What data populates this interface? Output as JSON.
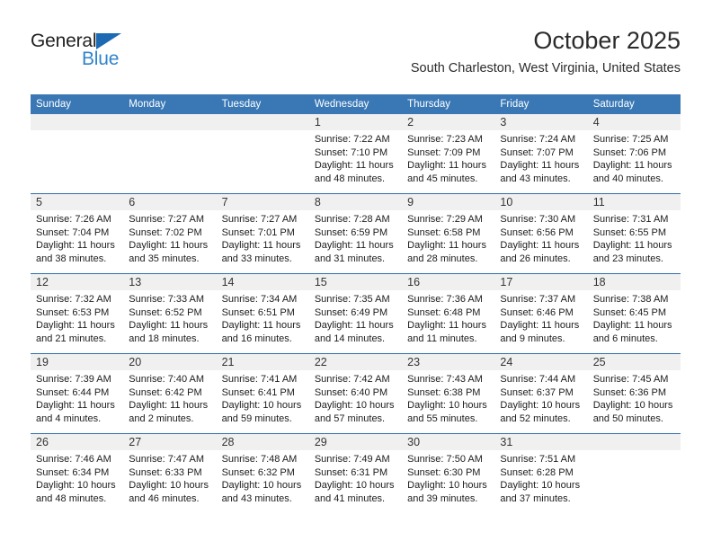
{
  "brand": {
    "name_part1": "General",
    "name_part2": "Blue",
    "triangle_color": "#1b6ab3",
    "blue_text_color": "#2f84cc"
  },
  "header": {
    "title": "October 2025",
    "subtitle": "South Charleston, West Virginia, United States"
  },
  "theme": {
    "header_blue": "#3a78b5",
    "row_divider_blue": "#2f6fad",
    "daynum_band": "#f0f0f0"
  },
  "weekdays": [
    "Sunday",
    "Monday",
    "Tuesday",
    "Wednesday",
    "Thursday",
    "Friday",
    "Saturday"
  ],
  "weeks": [
    [
      {
        "day": "",
        "sunrise": "",
        "sunset": "",
        "daylight1": "",
        "daylight2": ""
      },
      {
        "day": "",
        "sunrise": "",
        "sunset": "",
        "daylight1": "",
        "daylight2": ""
      },
      {
        "day": "",
        "sunrise": "",
        "sunset": "",
        "daylight1": "",
        "daylight2": ""
      },
      {
        "day": "1",
        "sunrise": "Sunrise: 7:22 AM",
        "sunset": "Sunset: 7:10 PM",
        "daylight1": "Daylight: 11 hours",
        "daylight2": "and 48 minutes."
      },
      {
        "day": "2",
        "sunrise": "Sunrise: 7:23 AM",
        "sunset": "Sunset: 7:09 PM",
        "daylight1": "Daylight: 11 hours",
        "daylight2": "and 45 minutes."
      },
      {
        "day": "3",
        "sunrise": "Sunrise: 7:24 AM",
        "sunset": "Sunset: 7:07 PM",
        "daylight1": "Daylight: 11 hours",
        "daylight2": "and 43 minutes."
      },
      {
        "day": "4",
        "sunrise": "Sunrise: 7:25 AM",
        "sunset": "Sunset: 7:06 PM",
        "daylight1": "Daylight: 11 hours",
        "daylight2": "and 40 minutes."
      }
    ],
    [
      {
        "day": "5",
        "sunrise": "Sunrise: 7:26 AM",
        "sunset": "Sunset: 7:04 PM",
        "daylight1": "Daylight: 11 hours",
        "daylight2": "and 38 minutes."
      },
      {
        "day": "6",
        "sunrise": "Sunrise: 7:27 AM",
        "sunset": "Sunset: 7:02 PM",
        "daylight1": "Daylight: 11 hours",
        "daylight2": "and 35 minutes."
      },
      {
        "day": "7",
        "sunrise": "Sunrise: 7:27 AM",
        "sunset": "Sunset: 7:01 PM",
        "daylight1": "Daylight: 11 hours",
        "daylight2": "and 33 minutes."
      },
      {
        "day": "8",
        "sunrise": "Sunrise: 7:28 AM",
        "sunset": "Sunset: 6:59 PM",
        "daylight1": "Daylight: 11 hours",
        "daylight2": "and 31 minutes."
      },
      {
        "day": "9",
        "sunrise": "Sunrise: 7:29 AM",
        "sunset": "Sunset: 6:58 PM",
        "daylight1": "Daylight: 11 hours",
        "daylight2": "and 28 minutes."
      },
      {
        "day": "10",
        "sunrise": "Sunrise: 7:30 AM",
        "sunset": "Sunset: 6:56 PM",
        "daylight1": "Daylight: 11 hours",
        "daylight2": "and 26 minutes."
      },
      {
        "day": "11",
        "sunrise": "Sunrise: 7:31 AM",
        "sunset": "Sunset: 6:55 PM",
        "daylight1": "Daylight: 11 hours",
        "daylight2": "and 23 minutes."
      }
    ],
    [
      {
        "day": "12",
        "sunrise": "Sunrise: 7:32 AM",
        "sunset": "Sunset: 6:53 PM",
        "daylight1": "Daylight: 11 hours",
        "daylight2": "and 21 minutes."
      },
      {
        "day": "13",
        "sunrise": "Sunrise: 7:33 AM",
        "sunset": "Sunset: 6:52 PM",
        "daylight1": "Daylight: 11 hours",
        "daylight2": "and 18 minutes."
      },
      {
        "day": "14",
        "sunrise": "Sunrise: 7:34 AM",
        "sunset": "Sunset: 6:51 PM",
        "daylight1": "Daylight: 11 hours",
        "daylight2": "and 16 minutes."
      },
      {
        "day": "15",
        "sunrise": "Sunrise: 7:35 AM",
        "sunset": "Sunset: 6:49 PM",
        "daylight1": "Daylight: 11 hours",
        "daylight2": "and 14 minutes."
      },
      {
        "day": "16",
        "sunrise": "Sunrise: 7:36 AM",
        "sunset": "Sunset: 6:48 PM",
        "daylight1": "Daylight: 11 hours",
        "daylight2": "and 11 minutes."
      },
      {
        "day": "17",
        "sunrise": "Sunrise: 7:37 AM",
        "sunset": "Sunset: 6:46 PM",
        "daylight1": "Daylight: 11 hours",
        "daylight2": "and 9 minutes."
      },
      {
        "day": "18",
        "sunrise": "Sunrise: 7:38 AM",
        "sunset": "Sunset: 6:45 PM",
        "daylight1": "Daylight: 11 hours",
        "daylight2": "and 6 minutes."
      }
    ],
    [
      {
        "day": "19",
        "sunrise": "Sunrise: 7:39 AM",
        "sunset": "Sunset: 6:44 PM",
        "daylight1": "Daylight: 11 hours",
        "daylight2": "and 4 minutes."
      },
      {
        "day": "20",
        "sunrise": "Sunrise: 7:40 AM",
        "sunset": "Sunset: 6:42 PM",
        "daylight1": "Daylight: 11 hours",
        "daylight2": "and 2 minutes."
      },
      {
        "day": "21",
        "sunrise": "Sunrise: 7:41 AM",
        "sunset": "Sunset: 6:41 PM",
        "daylight1": "Daylight: 10 hours",
        "daylight2": "and 59 minutes."
      },
      {
        "day": "22",
        "sunrise": "Sunrise: 7:42 AM",
        "sunset": "Sunset: 6:40 PM",
        "daylight1": "Daylight: 10 hours",
        "daylight2": "and 57 minutes."
      },
      {
        "day": "23",
        "sunrise": "Sunrise: 7:43 AM",
        "sunset": "Sunset: 6:38 PM",
        "daylight1": "Daylight: 10 hours",
        "daylight2": "and 55 minutes."
      },
      {
        "day": "24",
        "sunrise": "Sunrise: 7:44 AM",
        "sunset": "Sunset: 6:37 PM",
        "daylight1": "Daylight: 10 hours",
        "daylight2": "and 52 minutes."
      },
      {
        "day": "25",
        "sunrise": "Sunrise: 7:45 AM",
        "sunset": "Sunset: 6:36 PM",
        "daylight1": "Daylight: 10 hours",
        "daylight2": "and 50 minutes."
      }
    ],
    [
      {
        "day": "26",
        "sunrise": "Sunrise: 7:46 AM",
        "sunset": "Sunset: 6:34 PM",
        "daylight1": "Daylight: 10 hours",
        "daylight2": "and 48 minutes."
      },
      {
        "day": "27",
        "sunrise": "Sunrise: 7:47 AM",
        "sunset": "Sunset: 6:33 PM",
        "daylight1": "Daylight: 10 hours",
        "daylight2": "and 46 minutes."
      },
      {
        "day": "28",
        "sunrise": "Sunrise: 7:48 AM",
        "sunset": "Sunset: 6:32 PM",
        "daylight1": "Daylight: 10 hours",
        "daylight2": "and 43 minutes."
      },
      {
        "day": "29",
        "sunrise": "Sunrise: 7:49 AM",
        "sunset": "Sunset: 6:31 PM",
        "daylight1": "Daylight: 10 hours",
        "daylight2": "and 41 minutes."
      },
      {
        "day": "30",
        "sunrise": "Sunrise: 7:50 AM",
        "sunset": "Sunset: 6:30 PM",
        "daylight1": "Daylight: 10 hours",
        "daylight2": "and 39 minutes."
      },
      {
        "day": "31",
        "sunrise": "Sunrise: 7:51 AM",
        "sunset": "Sunset: 6:28 PM",
        "daylight1": "Daylight: 10 hours",
        "daylight2": "and 37 minutes."
      },
      {
        "day": "",
        "sunrise": "",
        "sunset": "",
        "daylight1": "",
        "daylight2": ""
      }
    ]
  ]
}
